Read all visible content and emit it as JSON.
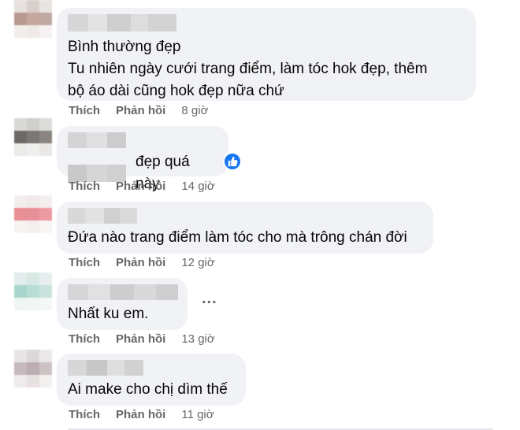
{
  "actions": {
    "like": "Thích",
    "reply": "Phản hồi"
  },
  "comments": [
    {
      "text": "Bình thường đẹp\nTu nhiên ngày cưới trang điểm, làm tóc hok đẹp, thêm\nbộ áo dài cũng hok đẹp nữa chứ",
      "time": "8 giờ"
    },
    {
      "text": "đẹp quá này",
      "time": "14 giờ",
      "reaction": "like"
    },
    {
      "text": "Đứa nào trang điểm làm tóc cho mà trông chán đời",
      "time": "12 giờ"
    },
    {
      "text": "Nhất ku em.",
      "time": "13 giờ",
      "more_menu": "..."
    },
    {
      "text": "Ai make cho chị dìm thế",
      "time": "11 giờ"
    }
  ],
  "colors": {
    "bubble": "#f0f2f5",
    "action_text": "#65676b",
    "like_blue": "#1877f2"
  }
}
